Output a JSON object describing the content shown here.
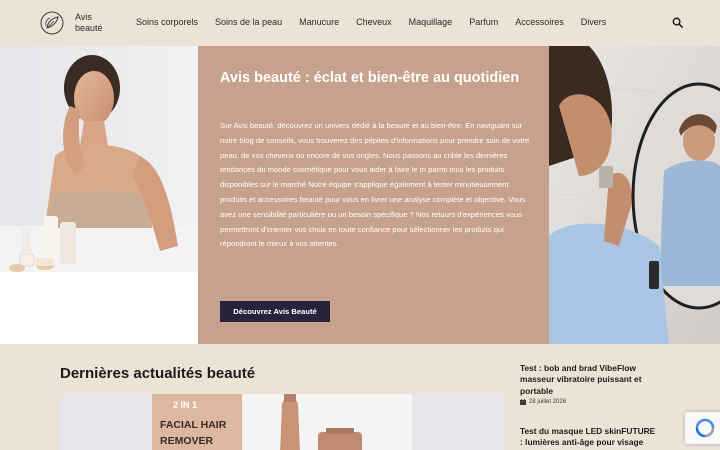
{
  "header": {
    "logo_text": "Avis beauté",
    "nav": [
      {
        "label": "Soins corporels"
      },
      {
        "label": "Soins de la peau"
      },
      {
        "label": "Manucure"
      },
      {
        "label": "Cheveux"
      },
      {
        "label": "Maquillage"
      },
      {
        "label": "Parfum"
      },
      {
        "label": "Accessoires"
      },
      {
        "label": "Divers"
      }
    ],
    "search_icon": "search-icon"
  },
  "hero": {
    "title": "Avis beauté : éclat et bien-être au quotidien",
    "text": "Sur Avis beauté, découvrez un univers dédié à la beauté et au bien-être. En naviguant sur notre blog de conseils, vous trouverez des pépites d'informations pour prendre soin de votre peau, de vos cheveux ou encore de vos ongles. Nous passons au crible les dernières tendances du monde cosmétique pour vous aider à faire le tri parmi tous les produits disponibles sur le marché Notre équipe s'applique également à tester minutieusement produits et accessoires beauté pour vous en livrer une analyse complète et objective. Vous avez une sensibilité particulière ou un besoin spécifique ? Nos retours d'expériences vous permettront d'orienter vos choix en toute confiance pour sélectionner les produits qui répondront le mieux à vos attentes.",
    "button_label": "Découvrez Avis Beauté"
  },
  "news": {
    "section_title": "Dernières actualités beauté",
    "image_text": [
      "2 IN 1",
      "FACIAL HAIR",
      "REMOVER"
    ]
  },
  "sidebar": {
    "posts": [
      {
        "title": "Test : bob and brad VibeFlow masseur vibratoire puissant et portable",
        "date": "28 juillet 2026"
      },
      {
        "title": "Test du masque LED skinFUTURE : lumières anti-âge pour visage",
        "date": ""
      }
    ]
  },
  "colors": {
    "page_bg": "#ede2d6",
    "hero_panel": "#c6a18c",
    "button_bg": "#27233a"
  }
}
